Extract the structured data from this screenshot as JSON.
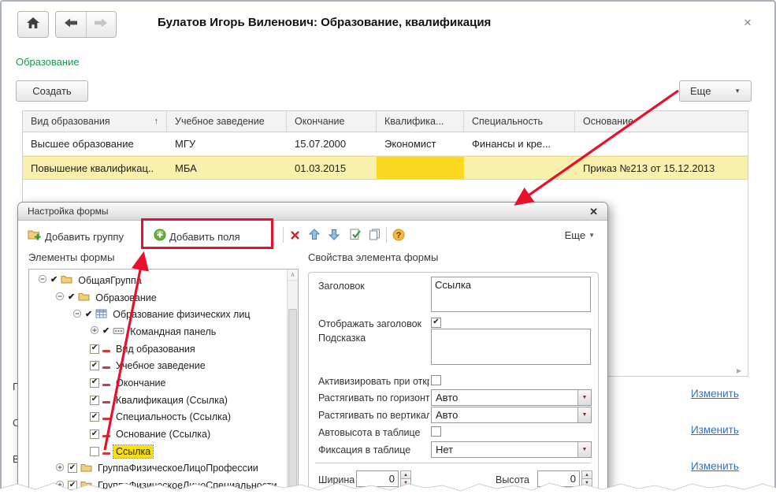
{
  "window": {
    "title": "Булатов Игорь Виленович: Образование, квалификация",
    "close_glyph": "×"
  },
  "toolbar": {
    "section_link": "Образование",
    "create_button": "Создать",
    "more_button": "Еще",
    "more_arrow": "▼"
  },
  "table": {
    "columns": [
      "Вид образования",
      "Учебное заведение",
      "Окончание",
      "Квалифика...",
      "Специальность",
      "Основание"
    ],
    "sort_indicator": "↑",
    "sort_column": 0,
    "corner_glyph": "▸",
    "rows": [
      {
        "cells": [
          "Высшее образование",
          "МГУ",
          "15.07.2000",
          "Экономист",
          "Финансы и кре...",
          ""
        ],
        "highlighted": false
      },
      {
        "cells": [
          "Повышение квалификац..",
          "МБА",
          "01.03.2015",
          "",
          "",
          "Приказ №213 от 15.12.2013"
        ],
        "highlighted": true,
        "selected_cell": 3
      }
    ]
  },
  "background": {
    "partial_labels": [
      "П",
      "С",
      "В"
    ],
    "links": [
      "Изменить",
      "Изменить",
      "Изменить"
    ]
  },
  "dialog": {
    "title": "Настройка формы",
    "close_glyph": "✕",
    "toolbar": {
      "add_group": "Добавить группу",
      "add_fields": "Добавить поля",
      "more": "Еще",
      "more_arrow": "▼"
    },
    "tree_label": "Элементы формы",
    "props_label": "Свойства элемента формы",
    "scroll_up_glyph": "∧",
    "tree": [
      {
        "label": "ОбщаяГруппа",
        "level": 0,
        "expander": "minus",
        "check": "tick",
        "icon": "folder-icon"
      },
      {
        "label": "Образование",
        "level": 1,
        "expander": "minus",
        "check": "tick",
        "icon": "folder-icon"
      },
      {
        "label": "Образование физических лиц",
        "level": 2,
        "expander": "minus",
        "check": "tick",
        "icon": "table-icon"
      },
      {
        "label": "Командная панель",
        "level": 3,
        "expander": "plus",
        "check": "tick",
        "icon": "cmdbar-icon"
      },
      {
        "label": "Вид образования",
        "level": 3,
        "expander": null,
        "check": "checked",
        "icon": "field-icon"
      },
      {
        "label": "Учебное заведение",
        "level": 3,
        "expander": null,
        "check": "checked",
        "icon": "field-icon"
      },
      {
        "label": "Окончание",
        "level": 3,
        "expander": null,
        "check": "checked",
        "icon": "field-icon"
      },
      {
        "label": "Квалификация (Ссылка)",
        "level": 3,
        "expander": null,
        "check": "checked",
        "icon": "field-icon"
      },
      {
        "label": "Специальность (Ссылка)",
        "level": 3,
        "expander": null,
        "check": "checked",
        "icon": "field-icon"
      },
      {
        "label": "Основание (Ссылка)",
        "level": 3,
        "expander": null,
        "check": "checked",
        "icon": "field-icon"
      },
      {
        "label": "Ссылка",
        "level": 3,
        "expander": null,
        "check": "unchecked",
        "icon": "field-icon",
        "selected": true
      },
      {
        "label": "ГруппаФизическоеЛицоПрофессии",
        "level": 1,
        "expander": "plus",
        "check": "checked",
        "icon": "folder-icon"
      },
      {
        "label": "ГруппаФизическоеЛицоСпециальности",
        "level": 1,
        "expander": "plus",
        "check": "checked",
        "icon": "folder-icon"
      }
    ],
    "props": {
      "title_field": {
        "label": "Заголовок",
        "value": "Ссылка"
      },
      "show_title": {
        "label": "Отображать заголовок",
        "checked": true
      },
      "hint": {
        "label": "Подсказка",
        "value": ""
      },
      "activate_on_open": {
        "label": "Активизировать при откры",
        "checked": false
      },
      "stretch_h": {
        "label": "Растягивать по горизонтал",
        "value": "Авто"
      },
      "stretch_v": {
        "label": "Растягивать по вертикали",
        "value": "Авто"
      },
      "auto_height": {
        "label": "Автовысота в таблице",
        "checked": false
      },
      "table_fix": {
        "label": "Фиксация в таблице",
        "value": "Нет"
      },
      "width": {
        "label": "Ширина",
        "value": "0"
      },
      "height": {
        "label": "Высота",
        "value": "0"
      }
    }
  },
  "annotation_color": "#e8112d"
}
